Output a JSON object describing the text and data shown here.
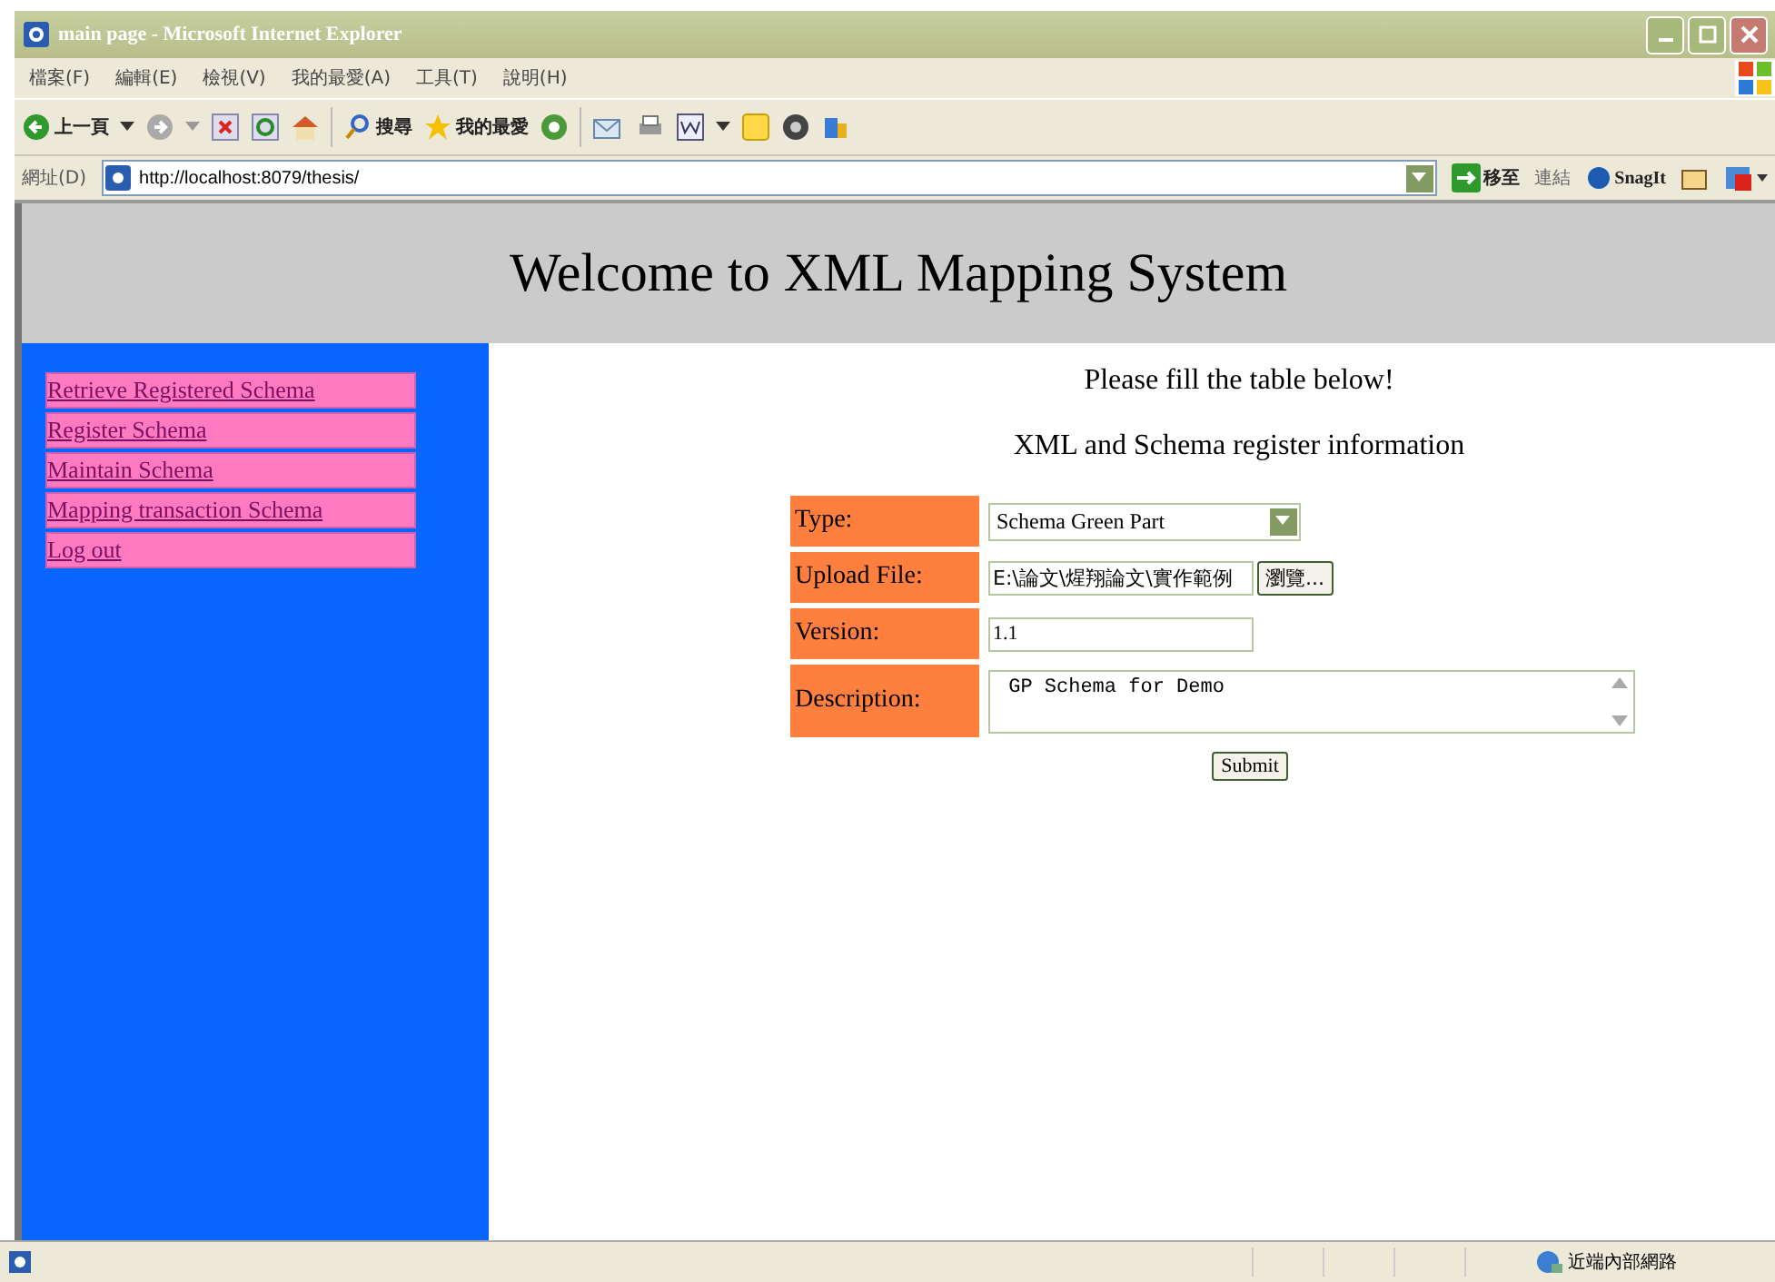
{
  "window": {
    "title": "main page - Microsoft Internet Explorer"
  },
  "menu": [
    "檔案(F)",
    "編輯(E)",
    "檢視(V)",
    "我的最愛(A)",
    "工具(T)",
    "說明(H)"
  ],
  "toolbar": {
    "back": "上一頁",
    "search": "搜尋",
    "favorites": "我的最愛"
  },
  "address_bar": {
    "label": "網址(D)",
    "url": "http://localhost:8079/thesis/",
    "go": "移至",
    "links": "連結",
    "snagit": "SnagIt"
  },
  "page": {
    "heading": "Welcome to XML Mapping System",
    "sidebar": [
      {
        "label": "Retrieve Registered Schema"
      },
      {
        "label": "Register Schema"
      },
      {
        "label": "Maintain Schema"
      },
      {
        "label": "Mapping transaction Schema"
      },
      {
        "label": "Log out"
      }
    ],
    "instruction": "Please fill the table below!",
    "form_title": "XML and Schema register information",
    "form": [
      {
        "kind": "select",
        "label": "Type:",
        "value": "Schema Green Part"
      },
      {
        "kind": "file",
        "label": "Upload File:",
        "value": "E:\\論文\\煋翔論文\\實作範例",
        "button": "瀏覽..."
      },
      {
        "kind": "text",
        "label": "Version:",
        "value": "1.1"
      },
      {
        "kind": "textarea",
        "label": "Description:",
        "value": " GP Schema for Demo"
      }
    ],
    "submit": "Submit"
  },
  "status_bar": {
    "zone": "近端內部網路"
  }
}
